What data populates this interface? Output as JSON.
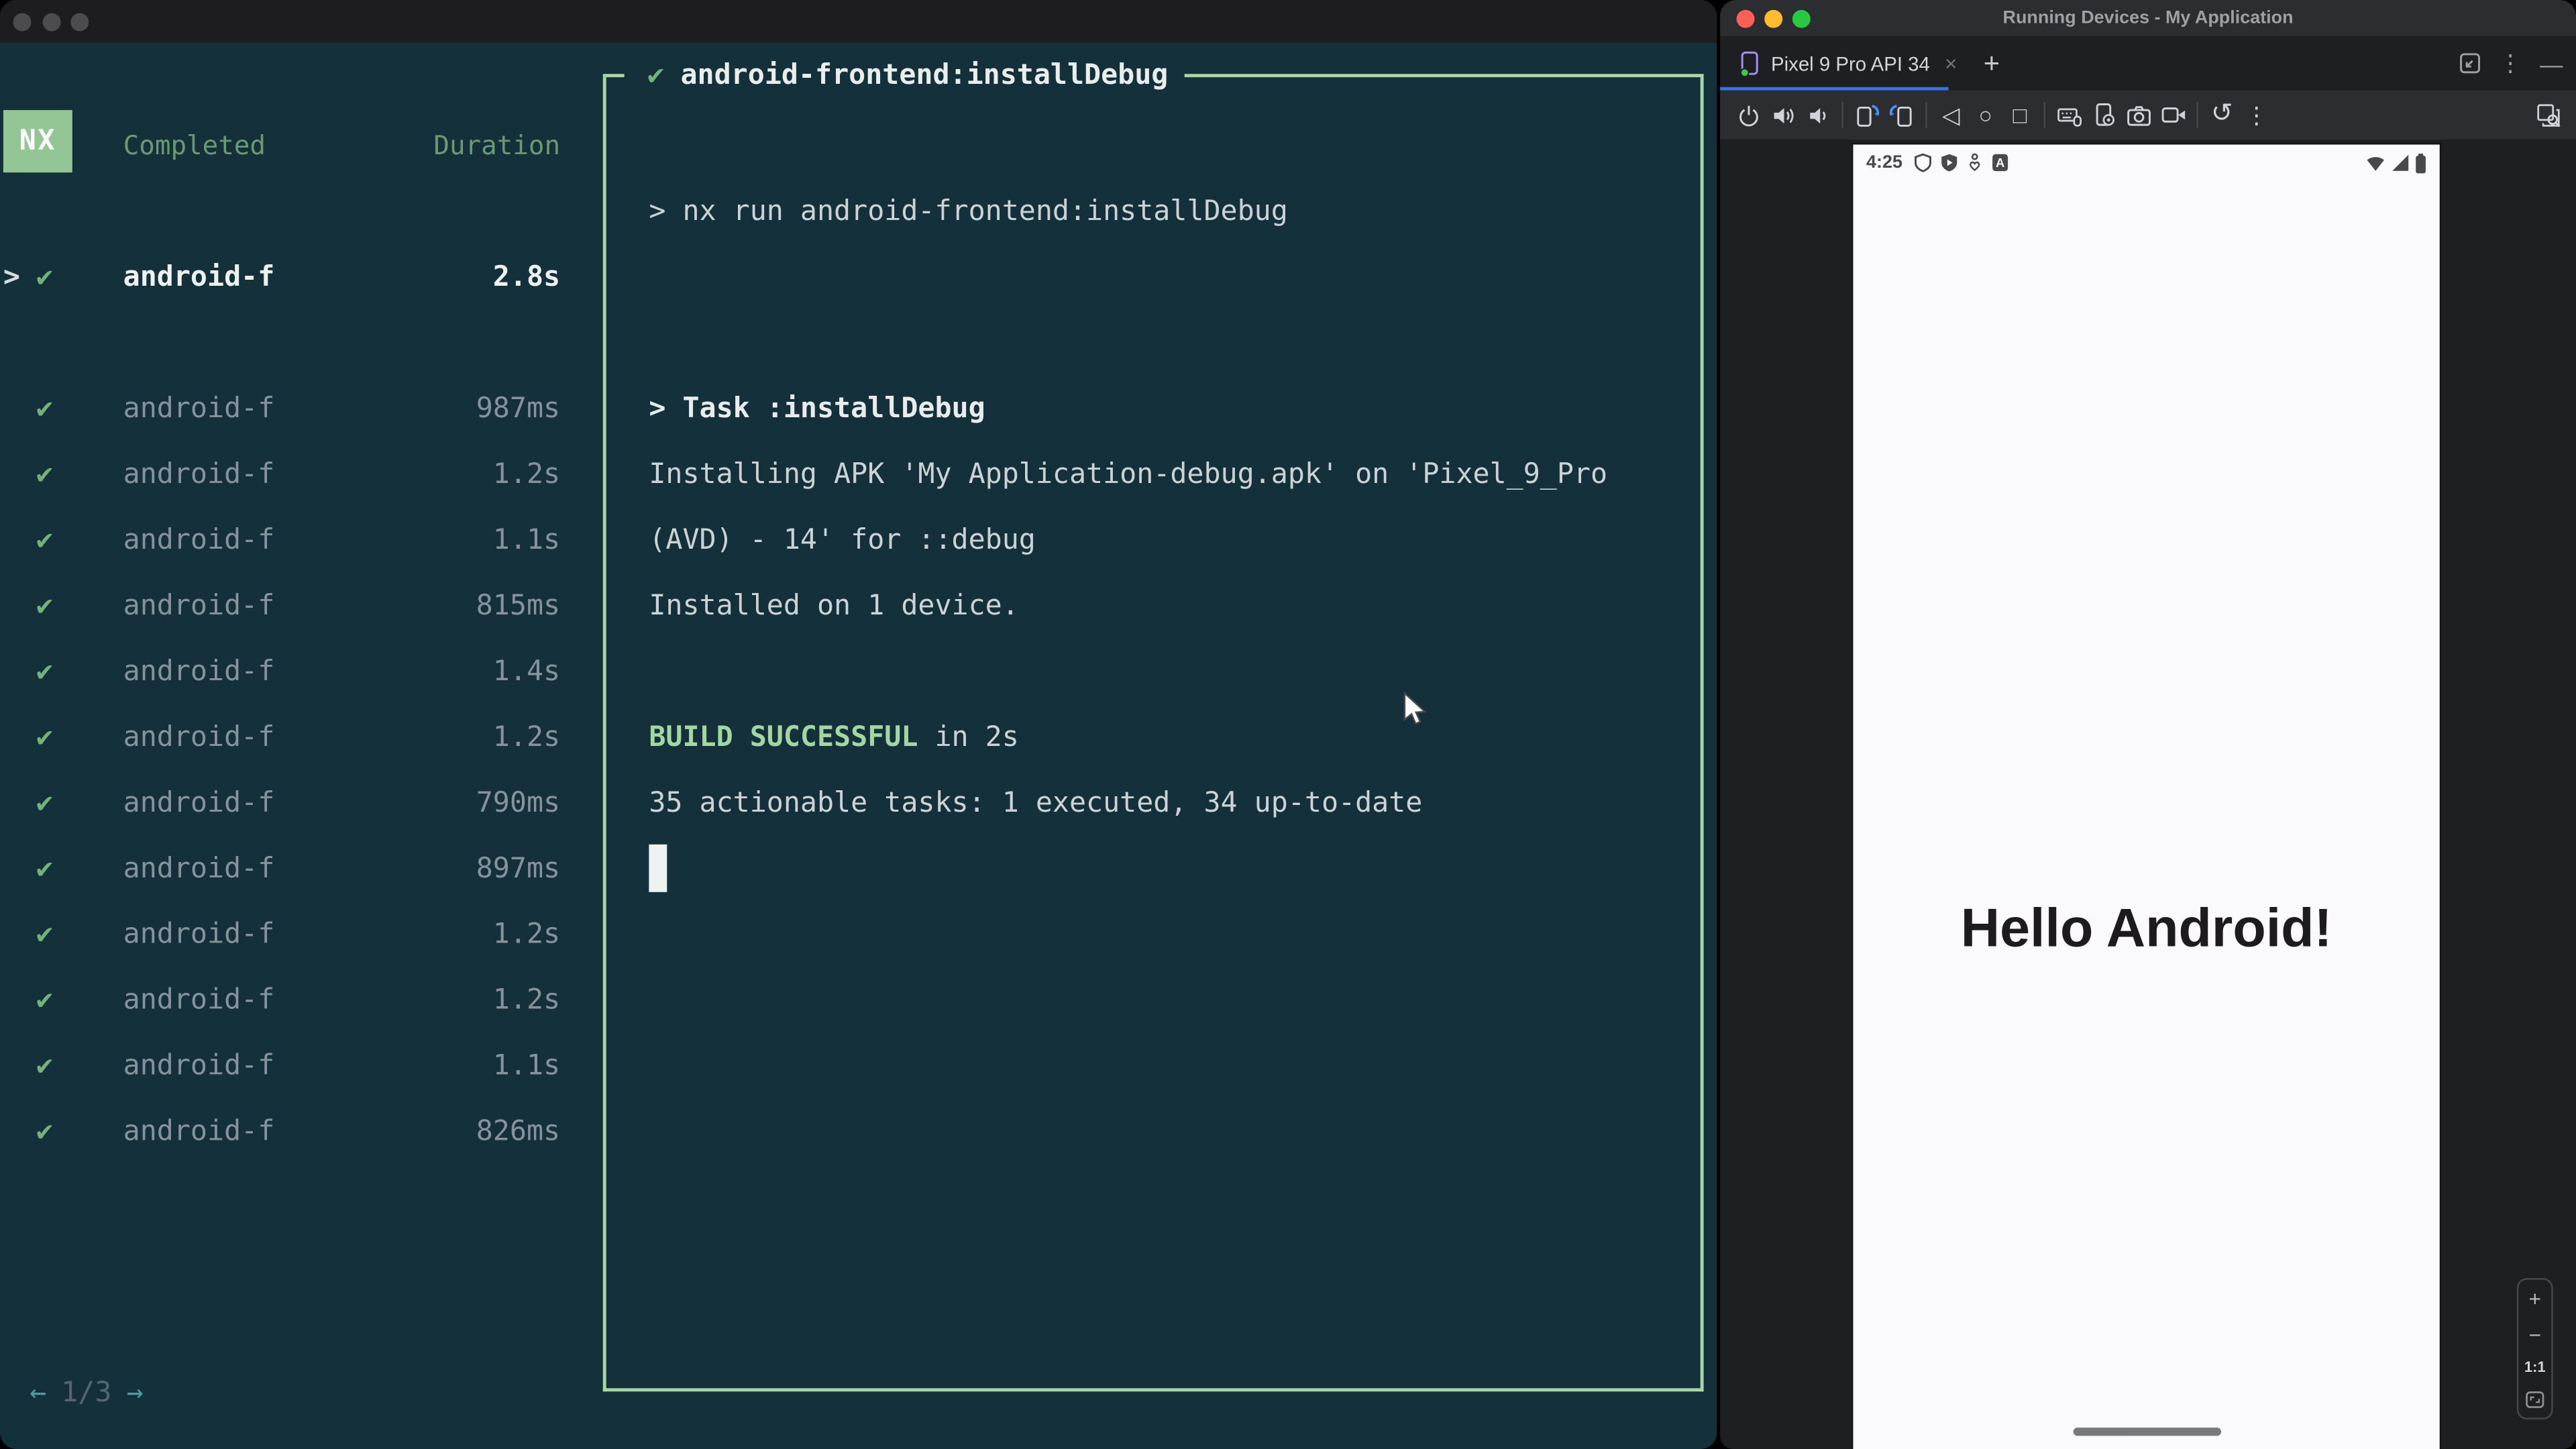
{
  "colors": {
    "terminal_bg": "#14313b",
    "nx_green": "#93c694",
    "box_border_green": "#a7d7a4",
    "success_green": "#a3d6a0",
    "header_green": "#6a9a72",
    "check_green": "#74b27c",
    "teal_arrow": "#4d9b9b",
    "panel_bg": "#1e1f22",
    "panel_bar_bg": "#2b2d30",
    "tab_underline_blue": "#3574f0",
    "traffic_red": "#ff5f57",
    "traffic_yellow": "#febc2e",
    "traffic_green": "#28c840",
    "device_screen_bg": "#f9f9fe",
    "device_text": "#1d1b20"
  },
  "left_window": {
    "nx_badge": "NX",
    "header": {
      "completed": "Completed",
      "duration": "Duration"
    },
    "selected_task": {
      "chevron": ">",
      "check": "✔",
      "name": "android-f",
      "duration": "2.8s"
    },
    "tasks": [
      {
        "check": "✔",
        "name": "android-f",
        "duration": "987ms"
      },
      {
        "check": "✔",
        "name": "android-f",
        "duration": "1.2s"
      },
      {
        "check": "✔",
        "name": "android-f",
        "duration": "1.1s"
      },
      {
        "check": "✔",
        "name": "android-f",
        "duration": "815ms"
      },
      {
        "check": "✔",
        "name": "android-f",
        "duration": "1.4s"
      },
      {
        "check": "✔",
        "name": "android-f",
        "duration": "1.2s"
      },
      {
        "check": "✔",
        "name": "android-f",
        "duration": "790ms"
      },
      {
        "check": "✔",
        "name": "android-f",
        "duration": "897ms"
      },
      {
        "check": "✔",
        "name": "android-f",
        "duration": "1.2s"
      },
      {
        "check": "✔",
        "name": "android-f",
        "duration": "1.2s"
      },
      {
        "check": "✔",
        "name": "android-f",
        "duration": "1.1s"
      },
      {
        "check": "✔",
        "name": "android-f",
        "duration": "826ms"
      }
    ],
    "pagination": {
      "prev": "←",
      "page": "1/3",
      "next": "→"
    }
  },
  "terminal_box": {
    "check": "✔",
    "title": "android-frontend:installDebug",
    "command": "> nx run android-frontend:installDebug",
    "task_header": "> Task :installDebug",
    "install_line1": "Installing APK 'My Application-debug.apk' on 'Pixel_9_Pro",
    "install_line2": "(AVD) - 14' for ::debug",
    "installed_line": "Installed on 1 device.",
    "build_status": "BUILD SUCCESSFUL",
    "build_time": " in 2s",
    "summary": "35 actionable tasks: 1 executed, 34 up-to-date"
  },
  "right_window": {
    "title": "Running Devices - My Application",
    "tab_label": "Pixel 9 Pro API 34",
    "tab_close": "×",
    "new_tab": "+",
    "more_glyph": "⋮",
    "minimize_glyph": "—",
    "glyphs": {
      "back": "◁",
      "home": "○",
      "overview": "□",
      "reset": "↺",
      "more": "⋮"
    },
    "emulator": {
      "time": "4:25",
      "hello": "Hello Android!",
      "zoom_in": "+",
      "zoom_out": "−",
      "actual_size": "1:1"
    }
  }
}
